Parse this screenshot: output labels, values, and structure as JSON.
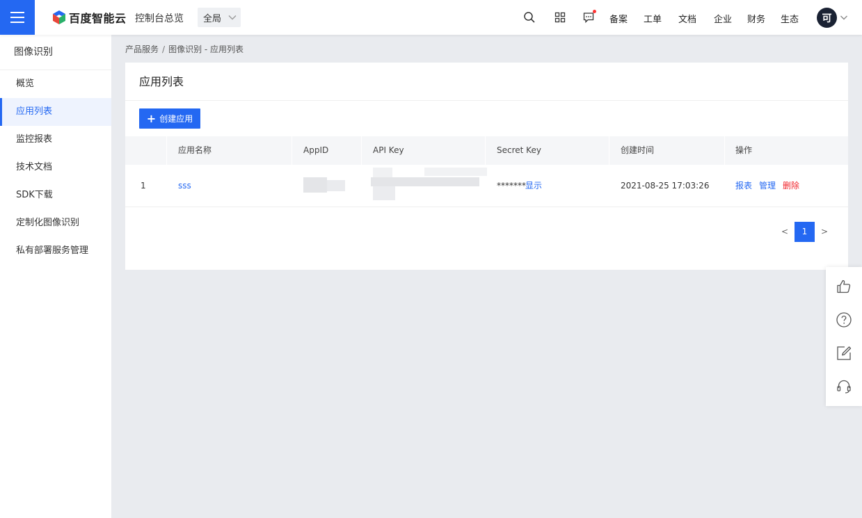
{
  "header": {
    "logo_text": "百度智能云",
    "console_label": "控制台总览",
    "region": "全局",
    "links": [
      "备案",
      "工单",
      "文档",
      "企业",
      "财务",
      "生态"
    ],
    "avatar_text": "可"
  },
  "sidebar": {
    "title": "图像识别",
    "items": [
      {
        "label": "概览"
      },
      {
        "label": "应用列表"
      },
      {
        "label": "监控报表"
      },
      {
        "label": "技术文档"
      },
      {
        "label": "SDK下载"
      },
      {
        "label": "定制化图像识别"
      },
      {
        "label": "私有部署服务管理"
      }
    ],
    "active_index": 1
  },
  "breadcrumb": {
    "root": "产品服务",
    "separator": "/",
    "current": "图像识别 - 应用列表"
  },
  "main": {
    "title": "应用列表",
    "create_button": "创建应用",
    "table": {
      "columns": [
        "应用名称",
        "AppID",
        "API Key",
        "Secret Key",
        "创建时间",
        "操作"
      ],
      "rows": [
        {
          "index": "1",
          "name": "sss",
          "secret_key": "*******",
          "show_label": "显示",
          "created": "2021-08-25 17:03:26",
          "actions": [
            "报表",
            "管理",
            "删除"
          ]
        }
      ]
    },
    "pagination": {
      "prev": "<",
      "current": "1",
      "next": ">"
    }
  },
  "colors": {
    "accent": "#2468f2",
    "danger": "#f0262d",
    "background": "#e9ebef"
  },
  "icons": {
    "rail": [
      "thumbs-up-icon",
      "help-circle-icon",
      "edit-icon",
      "headset-icon"
    ],
    "top": [
      "search-icon",
      "apps-grid-icon",
      "message-icon"
    ]
  }
}
